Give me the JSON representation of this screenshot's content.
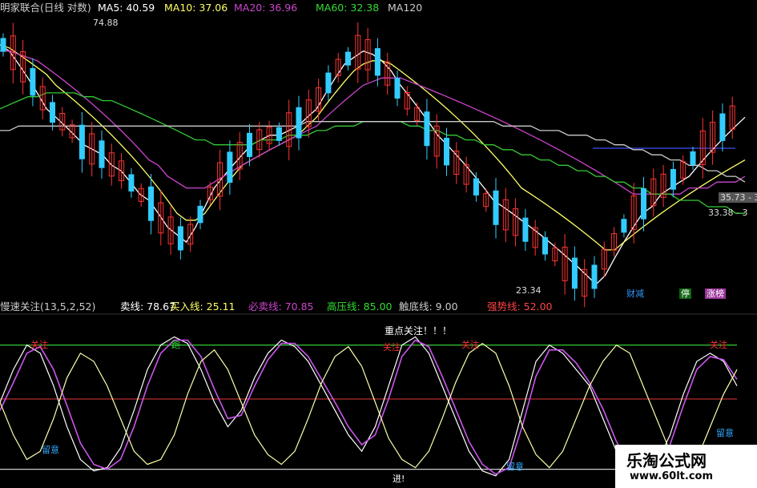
{
  "price_header": {
    "title": "明家联合(日线 对数)",
    "ma": [
      {
        "label": "MA5: 40.59",
        "color": "#ffffff"
      },
      {
        "label": "MA10: 37.06",
        "color": "#ffff66"
      },
      {
        "label": "MA20: 36.96",
        "color": "#cc44cc"
      },
      {
        "label": "MA60: 32.38",
        "color": "#33dd33"
      },
      {
        "label": "MA120",
        "color": "#cccccc"
      }
    ]
  },
  "price_annotations": {
    "high": "74.88",
    "low": "23.34",
    "right1": "35.73 - 3",
    "right2": "33.38 - 3"
  },
  "tags": {
    "t1": "财减",
    "t2": "停",
    "t3": "涨榜"
  },
  "indicator_header": {
    "name": "慢速关注(13,5,2,52)",
    "sell": "卖线: 78.67",
    "buy": "买入线: 25.11",
    "must": "必卖线: 70.85",
    "high": "高压线: 85.00",
    "bottom": "触底线: 9.00",
    "strong": "强势线: 52.00"
  },
  "indicator_annotations": {
    "focus": "重点关注！！！",
    "guanzhu": "关注",
    "pao": "跑",
    "liuyi": "留意",
    "jin": "进!"
  },
  "watermark": {
    "name": "乐淘公式网",
    "url": "www.60lt.com"
  },
  "chart_data": [
    {
      "type": "candlestick",
      "title": "明家联合(日线 对数)",
      "yscale": "log",
      "ylim": [
        23,
        80
      ],
      "annotations": [
        {
          "text": "74.88",
          "kind": "high"
        },
        {
          "text": "23.34",
          "kind": "low"
        }
      ],
      "series": [
        {
          "name": "MA5",
          "values": [
            70,
            68,
            64,
            60,
            56,
            52,
            50,
            48,
            46,
            44,
            43,
            42,
            40,
            39,
            37,
            35,
            34,
            32,
            30,
            29,
            28,
            30,
            33,
            36,
            38,
            40,
            42,
            44,
            45,
            46,
            46,
            47,
            48,
            50,
            52,
            56,
            60,
            64,
            66,
            68,
            67,
            65,
            62,
            58,
            55,
            52,
            49,
            46,
            44,
            42,
            40,
            38,
            36,
            34,
            33,
            32,
            31,
            30,
            29,
            28,
            27,
            26,
            25,
            24,
            23,
            24,
            26,
            28,
            30,
            32,
            33,
            35,
            36,
            37,
            38,
            40,
            42,
            44,
            46,
            48,
            50
          ]
        },
        {
          "name": "MA10",
          "values": [
            70,
            69,
            67,
            65,
            63,
            61,
            58,
            56,
            54,
            52,
            50,
            48,
            46,
            44,
            42,
            40,
            38,
            36,
            34,
            32,
            31,
            31,
            32,
            34,
            36,
            38,
            40,
            41,
            42,
            43,
            44,
            45,
            46,
            48,
            50,
            53,
            56,
            59,
            62,
            64,
            65,
            65,
            64,
            62,
            60,
            58,
            56,
            54,
            52,
            50,
            48,
            46,
            44,
            42,
            40,
            38,
            36,
            35,
            34,
            33,
            32,
            31,
            30,
            29,
            28,
            27,
            27,
            28,
            29,
            30,
            31,
            32,
            33,
            34,
            35,
            36,
            37,
            38,
            39,
            40,
            41
          ]
        },
        {
          "name": "MA20",
          "values": [
            68,
            68,
            67,
            66,
            65,
            63,
            61,
            59,
            57,
            55,
            53,
            51,
            49,
            47,
            45,
            43,
            41,
            40,
            38,
            37,
            36,
            36,
            36,
            37,
            38,
            39,
            40,
            41,
            42,
            43,
            44,
            45,
            46,
            47,
            48,
            50,
            52,
            54,
            56,
            58,
            59,
            60,
            60,
            60,
            59,
            58,
            57,
            56,
            55,
            54,
            53,
            52,
            51,
            50,
            49,
            48,
            47,
            46,
            45,
            44,
            43,
            42,
            41,
            40,
            39,
            38,
            37,
            36,
            35,
            35,
            35,
            35,
            35,
            35,
            36,
            36,
            36,
            37,
            37,
            37,
            38
          ]
        },
        {
          "name": "MA60",
          "values": [
            52,
            53,
            54,
            55,
            55,
            56,
            56,
            56,
            56,
            55,
            55,
            54,
            54,
            53,
            52,
            51,
            50,
            49,
            48,
            47,
            46,
            45,
            45,
            44,
            44,
            44,
            44,
            44,
            45,
            45,
            45,
            46,
            46,
            46,
            47,
            47,
            48,
            48,
            48,
            49,
            49,
            49,
            49,
            49,
            48,
            48,
            47,
            47,
            46,
            46,
            45,
            45,
            44,
            44,
            43,
            43,
            42,
            42,
            41,
            41,
            40,
            40,
            39,
            39,
            38,
            38,
            37,
            37,
            36,
            36,
            35,
            35,
            35,
            34,
            34,
            34,
            33,
            33,
            33,
            32,
            32
          ]
        },
        {
          "name": "MA120",
          "values": [
            47,
            47,
            48,
            48,
            48,
            48,
            48,
            48,
            48,
            48,
            48,
            48,
            48,
            48,
            48,
            48,
            48,
            48,
            48,
            48,
            48,
            48,
            48,
            48,
            48,
            48,
            48,
            48,
            48,
            48,
            48,
            48,
            48,
            49,
            49,
            49,
            49,
            49,
            49,
            49,
            49,
            49,
            49,
            49,
            49,
            49,
            49,
            49,
            49,
            49,
            49,
            49,
            49,
            49,
            48,
            48,
            48,
            48,
            47,
            47,
            47,
            46,
            46,
            46,
            45,
            45,
            44,
            44,
            43,
            43,
            42,
            42,
            41,
            41,
            40,
            40,
            39,
            39,
            38,
            38,
            37
          ]
        }
      ]
    },
    {
      "type": "line",
      "title": "慢速关注(13,5,2,52)",
      "ylim": [
        0,
        100
      ],
      "reference_lines": [
        {
          "name": "高压线",
          "value": 85,
          "color": "#33cc33"
        },
        {
          "name": "强势线",
          "value": 52,
          "color": "#cc3333"
        },
        {
          "name": "触底线",
          "value": 9,
          "color": "#cccccc"
        }
      ],
      "series": [
        {
          "name": "卖线",
          "values": [
            50,
            70,
            85,
            80,
            60,
            35,
            15,
            8,
            10,
            22,
            45,
            70,
            85,
            90,
            86,
            70,
            50,
            35,
            45,
            65,
            80,
            88,
            84,
            75,
            60,
            45,
            30,
            20,
            35,
            60,
            85,
            90,
            80,
            60,
            40,
            20,
            8,
            5,
            15,
            45,
            75,
            85,
            80,
            70,
            60,
            40,
            20,
            8,
            6,
            12,
            30,
            55,
            75,
            80,
            75,
            60
          ]
        },
        {
          "name": "必卖线",
          "values": [
            45,
            62,
            80,
            84,
            70,
            48,
            25,
            12,
            9,
            15,
            35,
            60,
            80,
            88,
            88,
            78,
            58,
            40,
            42,
            60,
            76,
            86,
            86,
            78,
            64,
            50,
            35,
            24,
            30,
            52,
            78,
            88,
            84,
            66,
            46,
            26,
            12,
            6,
            10,
            36,
            66,
            82,
            82,
            74,
            62,
            46,
            26,
            12,
            7,
            9,
            24,
            48,
            70,
            78,
            76,
            64
          ]
        },
        {
          "name": "买入线",
          "values": [
            50,
            30,
            15,
            20,
            40,
            65,
            80,
            75,
            60,
            40,
            20,
            12,
            15,
            30,
            55,
            75,
            82,
            70,
            50,
            30,
            18,
            12,
            20,
            40,
            62,
            78,
            84,
            72,
            50,
            28,
            15,
            10,
            20,
            40,
            62,
            80,
            86,
            80,
            60,
            35,
            18,
            10,
            20,
            40,
            60,
            75,
            85,
            80,
            60,
            40,
            20,
            12,
            15,
            35,
            55,
            70
          ]
        }
      ]
    }
  ]
}
